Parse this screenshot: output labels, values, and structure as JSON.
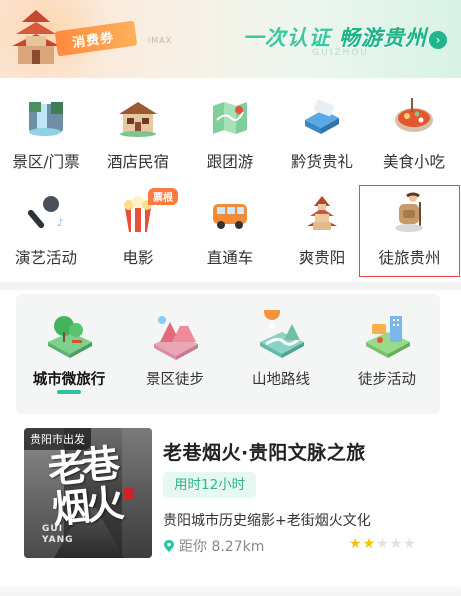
{
  "banner": {
    "tag_label": "消费券",
    "imax_text": "IMAX",
    "slogan_part1": "一次认证",
    "slogan_part2": "畅游贵州",
    "subtext": "GUIZHOU",
    "go_icon": "chevron-right-icon",
    "accent_color": "#1fb38a"
  },
  "categories": [
    {
      "label": "景区/门票",
      "icon": "waterfall-scenic-icon"
    },
    {
      "label": "酒店民宿",
      "icon": "hotel-house-icon"
    },
    {
      "label": "跟团游",
      "icon": "map-icon"
    },
    {
      "label": "黔货贵礼",
      "icon": "gift-package-icon"
    },
    {
      "label": "美食小吃",
      "icon": "hotpot-food-icon"
    },
    {
      "label": "演艺活动",
      "icon": "microphone-icon"
    },
    {
      "label": "电影",
      "icon": "popcorn-icon",
      "badge": "票根"
    },
    {
      "label": "直通车",
      "icon": "bus-icon"
    },
    {
      "label": "爽贵阳",
      "icon": "pavilion-tower-icon"
    },
    {
      "label": "徒旅贵州",
      "icon": "hiker-icon",
      "highlighted": true
    }
  ],
  "themes": [
    {
      "label": "城市微旅行",
      "icon": "city-park-icon",
      "active": true
    },
    {
      "label": "景区徒步",
      "icon": "mountain-scenic-icon",
      "active": false
    },
    {
      "label": "山地路线",
      "icon": "mountain-route-icon",
      "active": false
    },
    {
      "label": "徒步活动",
      "icon": "hiking-activity-icon",
      "active": false
    }
  ],
  "route_card": {
    "origin_tag": "贵阳市出发",
    "image_text": "老巷烟火",
    "image_text_latin_1": "GUI",
    "image_text_latin_2": "YANG",
    "title": "老巷烟火·贵阳文脉之旅",
    "duration": "用时12小时",
    "description": "贵阳城市历史缩影+老街烟火文化",
    "distance": "距你 8.27km",
    "rating": 2,
    "rating_max": 5,
    "star_color": "#f2c400"
  }
}
